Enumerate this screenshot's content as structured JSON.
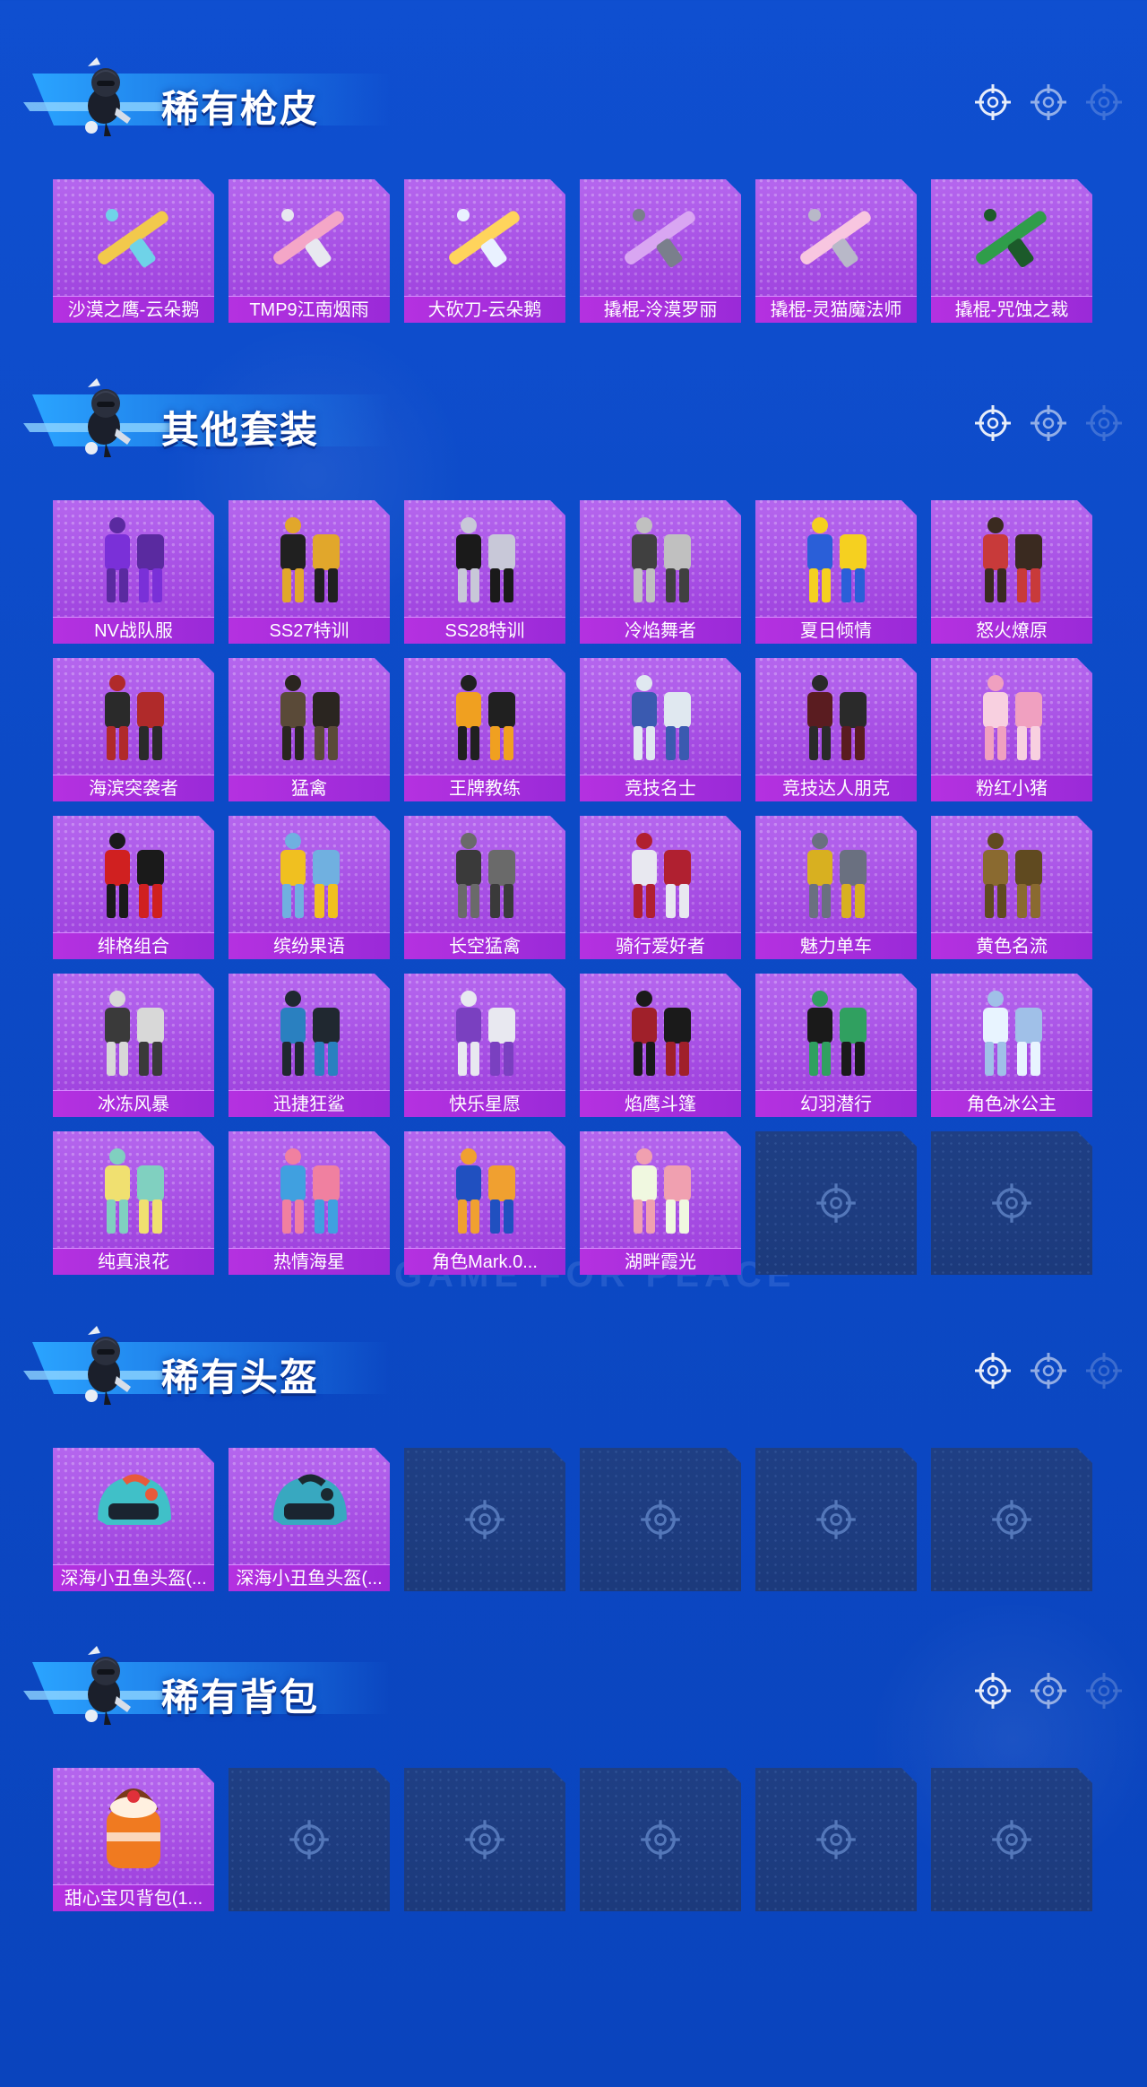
{
  "sections": [
    {
      "title": "稀有枪皮",
      "items": [
        "沙漠之鹰-云朵鹅",
        "TMP9江南烟雨",
        "大砍刀-云朵鹅",
        "撬棍-泠漠罗丽",
        "撬棍-灵猫魔法师",
        "撬棍-咒蚀之裁"
      ],
      "empty_slots": 0
    },
    {
      "title": "其他套装",
      "items": [
        "NV战队服",
        "SS27特训",
        "SS28特训",
        "冷焰舞者",
        "夏日倾情",
        "怒火燎原",
        "海滨突袭者",
        "猛禽",
        "王牌教练",
        "竞技名士",
        "竞技达人朋克",
        "粉红小猪",
        "绯格组合",
        "缤纷果语",
        "长空猛禽",
        "骑行爱好者",
        "魅力单车",
        "黄色名流",
        "冰冻风暴",
        "迅捷狂鲨",
        "快乐星愿",
        "焰鹰斗篷",
        "幻羽潜行",
        "角色冰公主",
        "纯真浪花",
        "热情海星",
        "角色Mark.0...",
        "湖畔霞光"
      ],
      "empty_slots": 2
    },
    {
      "title": "稀有头盔",
      "items": [
        "深海小丑鱼头盔(...",
        "深海小丑鱼头盔(..."
      ],
      "empty_slots": 4
    },
    {
      "title": "稀有背包",
      "items": [
        "甜心宝贝背包(1..."
      ],
      "empty_slots": 5
    }
  ],
  "watermark": "GAME FOR PEACE",
  "colors": {
    "background": "#0f4fd0",
    "card_filled": "#ad55e8",
    "card_label": "#b531e0",
    "card_empty": "#1f3f84",
    "title_text": "#ffffff"
  },
  "icons": {
    "header_indicator": "crosshair-target-icon",
    "empty_slot": "crosshair-target-icon",
    "mascot": "mascot-character-icon"
  }
}
